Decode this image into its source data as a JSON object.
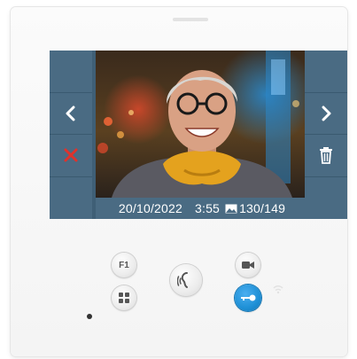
{
  "screen": {
    "status_bar": {
      "date": "20/10/2022",
      "time": "3:55",
      "image_counter": "130/149"
    },
    "left_buttons": [
      {
        "icon": "chevron-left-icon"
      },
      {
        "icon": "close-icon",
        "color": "#e0322b"
      }
    ],
    "right_buttons": [
      {
        "icon": "chevron-right-icon"
      },
      {
        "icon": "trash-icon"
      }
    ]
  },
  "panel": {
    "buttons": [
      {
        "label": "F1"
      },
      {
        "icon": "grid-icon"
      },
      {
        "icon": "intercom-icon"
      },
      {
        "icon": "camera-icon"
      },
      {
        "icon": "key-icon",
        "color": "#1e90d6"
      }
    ]
  },
  "colors": {
    "screen_frame": "#4a6b83",
    "key_button": "#1e90d6",
    "close_icon": "#e0322b"
  }
}
